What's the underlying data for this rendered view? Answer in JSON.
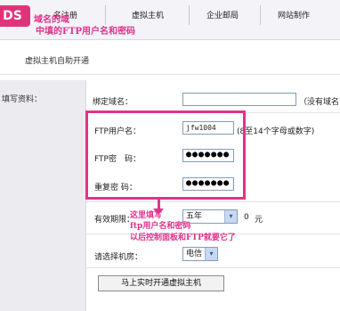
{
  "nav": {
    "logo_text": "DS",
    "items": [
      "名注册",
      "虚拟主机",
      "企业邮局",
      "网站制作"
    ]
  },
  "overlay_top": {
    "line1": "域名的域",
    "line2": "中填的FTP用户名和密码"
  },
  "breadcrumb": "虚拟主机自助开通",
  "left_label": "填写资料：",
  "form": {
    "bind_domain_label": "绑定域名：",
    "bind_domain_value": "",
    "bind_domain_hint": "（没有域名",
    "ftp_user_label": "FTP用户名：",
    "ftp_user_value": "jfw1004",
    "ftp_user_hint": "(8至14个字母或数字)",
    "ftp_pass_label": "FTP密　码：",
    "ftp_pass_value": "●●●●●●●",
    "confirm_pass_label": "重复密 码：",
    "confirm_pass_value": "●●●●●●●",
    "period_label": "有效期限：",
    "period_value": "五年",
    "price_value": "0",
    "price_unit": "元",
    "room_label": "请选择机房：",
    "room_value": "电信",
    "submit_label": "马上实时开通虚拟主机"
  },
  "annotation": {
    "line1": "这里填写",
    "line2": "ftp用户名和密码",
    "line3": "以后控制面板和FTP就要它了"
  },
  "colors": {
    "accent": "#e0338c",
    "input_border": "#7f9db9"
  }
}
